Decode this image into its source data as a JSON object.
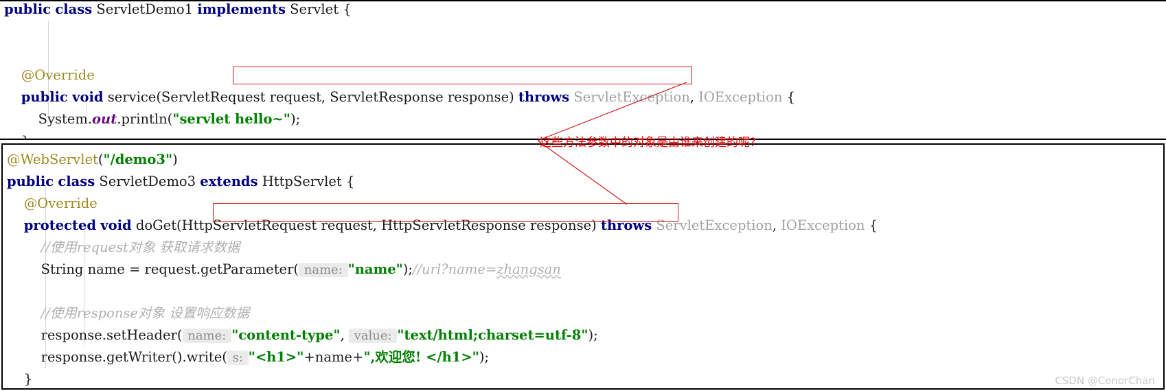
{
  "editor": {
    "language": "java",
    "theme_background": "#ffffff",
    "colors": {
      "keyword": "#000080",
      "string": "#008000",
      "annotation": "#9e8820",
      "comment": "#b0b0b0",
      "class_gray": "#a0a0a0",
      "static_field": "#660e7a",
      "param_hint_bg": "#ebebeb",
      "param_hint_fg": "#8c8c8c",
      "markup_red": "#d01919",
      "annotation_text_red": "#ff0000",
      "panel_border": "#000000"
    }
  },
  "top_block": {
    "name": "ServletDemo1",
    "lines": [
      {
        "id": "t1",
        "tokens": [
          {
            "t": "public",
            "c": "kw"
          },
          {
            "t": " ",
            "c": "plain"
          },
          {
            "t": "class",
            "c": "kw"
          },
          {
            "t": " ServletDemo1 ",
            "c": "cls"
          },
          {
            "t": "implements",
            "c": "kw"
          },
          {
            "t": " Servlet {",
            "c": "cls"
          }
        ]
      },
      {
        "id": "t2",
        "tokens": []
      },
      {
        "id": "t3",
        "tokens": []
      },
      {
        "id": "t4",
        "tokens": [
          {
            "t": "    @Override",
            "c": "anno"
          }
        ]
      },
      {
        "id": "t5",
        "tokens": [
          {
            "t": "    ",
            "c": "plain"
          },
          {
            "t": "public",
            "c": "kw"
          },
          {
            "t": " ",
            "c": "plain"
          },
          {
            "t": "void",
            "c": "kw"
          },
          {
            "t": " service(",
            "c": "plain"
          },
          {
            "t": "ServletRequest request, ServletResponse response",
            "c": "plain"
          },
          {
            "t": ") ",
            "c": "plain"
          },
          {
            "t": "throws",
            "c": "kw"
          },
          {
            "t": " ",
            "c": "plain"
          },
          {
            "t": "ServletException",
            "c": "gray"
          },
          {
            "t": ", ",
            "c": "plain"
          },
          {
            "t": "IOException",
            "c": "gray"
          },
          {
            "t": " {",
            "c": "plain"
          }
        ]
      },
      {
        "id": "t6",
        "tokens": [
          {
            "t": "        System.",
            "c": "plain"
          },
          {
            "t": "out",
            "c": "field"
          },
          {
            "t": ".println(",
            "c": "plain"
          },
          {
            "t": "\"servlet hello~\"",
            "c": "str"
          },
          {
            "t": ");",
            "c": "plain"
          }
        ]
      },
      {
        "id": "t7",
        "tokens": [
          {
            "t": "    }",
            "c": "plain"
          }
        ]
      }
    ]
  },
  "bottom_block": {
    "name": "ServletDemo3",
    "lines": [
      {
        "id": "b1",
        "tokens": [
          {
            "t": "@WebServlet",
            "c": "anno"
          },
          {
            "t": "(",
            "c": "plain"
          },
          {
            "t": "\"/demo3\"",
            "c": "str"
          },
          {
            "t": ")",
            "c": "plain"
          }
        ]
      },
      {
        "id": "b2",
        "tokens": [
          {
            "t": "public",
            "c": "kw"
          },
          {
            "t": " ",
            "c": "plain"
          },
          {
            "t": "class",
            "c": "kw"
          },
          {
            "t": " ServletDemo3 ",
            "c": "cls"
          },
          {
            "t": "extends",
            "c": "kw"
          },
          {
            "t": " HttpServlet {",
            "c": "cls"
          }
        ]
      },
      {
        "id": "b3",
        "tokens": [
          {
            "t": "    @Override",
            "c": "anno"
          }
        ]
      },
      {
        "id": "b4",
        "tokens": [
          {
            "t": "    ",
            "c": "plain"
          },
          {
            "t": "protected",
            "c": "kw"
          },
          {
            "t": " ",
            "c": "plain"
          },
          {
            "t": "void",
            "c": "kw"
          },
          {
            "t": " doGet(",
            "c": "plain"
          },
          {
            "t": "HttpServletRequest request, HttpServletResponse response",
            "c": "plain"
          },
          {
            "t": ") ",
            "c": "plain"
          },
          {
            "t": "throws",
            "c": "kw"
          },
          {
            "t": " ",
            "c": "plain"
          },
          {
            "t": "ServletException",
            "c": "gray"
          },
          {
            "t": ", ",
            "c": "plain"
          },
          {
            "t": "IOException",
            "c": "gray"
          },
          {
            "t": " {",
            "c": "plain"
          }
        ]
      },
      {
        "id": "b5",
        "tokens": [
          {
            "t": "        //使用request对象 获取请求数据",
            "c": "comment"
          }
        ]
      },
      {
        "id": "b6",
        "tokens": [
          {
            "t": "        String name = request.getParameter(",
            "c": "plain"
          },
          {
            "t": " name: ",
            "c": "hint"
          },
          {
            "t": "\"name\"",
            "c": "str"
          },
          {
            "t": ");",
            "c": "plain"
          },
          {
            "t": "//url?name=",
            "c": "comment"
          },
          {
            "t": "zhangsan",
            "c": "comment wavy"
          }
        ]
      },
      {
        "id": "b7",
        "tokens": []
      },
      {
        "id": "b8",
        "tokens": [
          {
            "t": "        //使用response对象 设置响应数据",
            "c": "comment"
          }
        ]
      },
      {
        "id": "b9",
        "tokens": [
          {
            "t": "        response.setHeader(",
            "c": "plain"
          },
          {
            "t": " name: ",
            "c": "hint"
          },
          {
            "t": "\"content-type\"",
            "c": "str"
          },
          {
            "t": ", ",
            "c": "plain"
          },
          {
            "t": " value: ",
            "c": "hint"
          },
          {
            "t": "\"text/html;charset=utf-8\"",
            "c": "str"
          },
          {
            "t": ");",
            "c": "plain"
          }
        ]
      },
      {
        "id": "b10",
        "tokens": [
          {
            "t": "        response.getWriter().write(",
            "c": "plain"
          },
          {
            "t": " s: ",
            "c": "hint"
          },
          {
            "t": "\"<h1>\"",
            "c": "str"
          },
          {
            "t": "+name+",
            "c": "plain"
          },
          {
            "t": "\",欢迎您! </h1>\"",
            "c": "str"
          },
          {
            "t": ");",
            "c": "plain"
          }
        ]
      },
      {
        "id": "b11",
        "tokens": [
          {
            "t": "    }",
            "c": "plain"
          }
        ]
      }
    ]
  },
  "markup": {
    "annotation_text": "这些方法参数中的对象是由谁来创建的呢?",
    "highlight_box_top_label": "ServletRequest request, ServletResponse response",
    "highlight_box_bottom_label": "HttpServletRequest request, HttpServletResponse response"
  },
  "watermark": {
    "text": "CSDN @ConorChan"
  }
}
